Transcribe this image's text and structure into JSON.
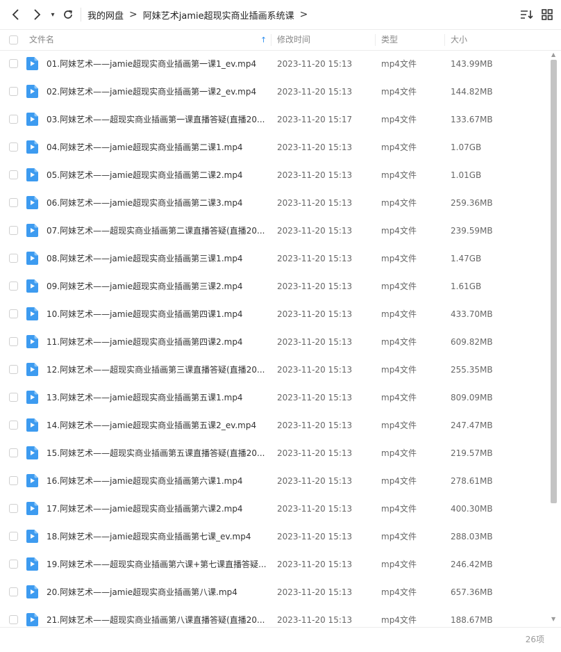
{
  "toolbar": {
    "breadcrumbs": [
      "我的网盘",
      "阿妹艺术jamie超现实商业插画系统课"
    ],
    "separator": ">"
  },
  "header": {
    "name": "文件名",
    "modified": "修改时间",
    "type": "类型",
    "size": "大小",
    "sort_indicator": "↑"
  },
  "files": [
    {
      "name": "01.阿妹艺术——jamie超现实商业插画第一课1_ev.mp4",
      "modified": "2023-11-20 15:13",
      "type": "mp4文件",
      "size": "143.99MB"
    },
    {
      "name": "02.阿妹艺术——jamie超现实商业插画第一课2_ev.mp4",
      "modified": "2023-11-20 15:13",
      "type": "mp4文件",
      "size": "144.82MB"
    },
    {
      "name": "03.阿妹艺术——超现实商业插画第一课直播答疑(直播20...",
      "modified": "2023-11-20 15:17",
      "type": "mp4文件",
      "size": "133.67MB"
    },
    {
      "name": "04.阿妹艺术——jamie超现实商业插画第二课1.mp4",
      "modified": "2023-11-20 15:13",
      "type": "mp4文件",
      "size": "1.07GB"
    },
    {
      "name": "05.阿妹艺术——jamie超现实商业插画第二课2.mp4",
      "modified": "2023-11-20 15:13",
      "type": "mp4文件",
      "size": "1.01GB"
    },
    {
      "name": "06.阿妹艺术——jamie超现实商业插画第二课3.mp4",
      "modified": "2023-11-20 15:13",
      "type": "mp4文件",
      "size": "259.36MB"
    },
    {
      "name": "07.阿妹艺术——超现实商业插画第二课直播答疑(直播20...",
      "modified": "2023-11-20 15:13",
      "type": "mp4文件",
      "size": "239.59MB"
    },
    {
      "name": "08.阿妹艺术——jamie超现实商业插画第三课1.mp4",
      "modified": "2023-11-20 15:13",
      "type": "mp4文件",
      "size": "1.47GB"
    },
    {
      "name": "09.阿妹艺术——jamie超现实商业插画第三课2.mp4",
      "modified": "2023-11-20 15:13",
      "type": "mp4文件",
      "size": "1.61GB"
    },
    {
      "name": "10.阿妹艺术——jamie超现实商业插画第四课1.mp4",
      "modified": "2023-11-20 15:13",
      "type": "mp4文件",
      "size": "433.70MB"
    },
    {
      "name": "11.阿妹艺术——jamie超现实商业插画第四课2.mp4",
      "modified": "2023-11-20 15:13",
      "type": "mp4文件",
      "size": "609.82MB"
    },
    {
      "name": "12.阿妹艺术——超现实商业插画第三课直播答疑(直播20...",
      "modified": "2023-11-20 15:13",
      "type": "mp4文件",
      "size": "255.35MB"
    },
    {
      "name": "13.阿妹艺术——jamie超现实商业插画第五课1.mp4",
      "modified": "2023-11-20 15:13",
      "type": "mp4文件",
      "size": "809.09MB"
    },
    {
      "name": "14.阿妹艺术——jamie超现实商业插画第五课2_ev.mp4",
      "modified": "2023-11-20 15:13",
      "type": "mp4文件",
      "size": "247.47MB"
    },
    {
      "name": "15.阿妹艺术——超现实商业插画第五课直播答疑(直播20...",
      "modified": "2023-11-20 15:13",
      "type": "mp4文件",
      "size": "219.57MB"
    },
    {
      "name": "16.阿妹艺术——jamie超现实商业插画第六课1.mp4",
      "modified": "2023-11-20 15:13",
      "type": "mp4文件",
      "size": "278.61MB"
    },
    {
      "name": "17.阿妹艺术——jamie超现实商业插画第六课2.mp4",
      "modified": "2023-11-20 15:13",
      "type": "mp4文件",
      "size": "400.30MB"
    },
    {
      "name": "18.阿妹艺术——jamie超现实商业插画第七课_ev.mp4",
      "modified": "2023-11-20 15:13",
      "type": "mp4文件",
      "size": "288.03MB"
    },
    {
      "name": "19.阿妹艺术——超现实商业插画第六课+第七课直播答疑...",
      "modified": "2023-11-20 15:13",
      "type": "mp4文件",
      "size": "246.42MB"
    },
    {
      "name": "20.阿妹艺术——jamie超现实商业插画第八课.mp4",
      "modified": "2023-11-20 15:13",
      "type": "mp4文件",
      "size": "657.36MB"
    },
    {
      "name": "21.阿妹艺术——超现实商业插画第八课直播答疑(直播20...",
      "modified": "2023-11-20 15:13",
      "type": "mp4文件",
      "size": "188.67MB"
    }
  ],
  "footer": {
    "count": "26项"
  },
  "colors": {
    "accent": "#2f8fef",
    "file_icon": "#3d9bf0"
  }
}
